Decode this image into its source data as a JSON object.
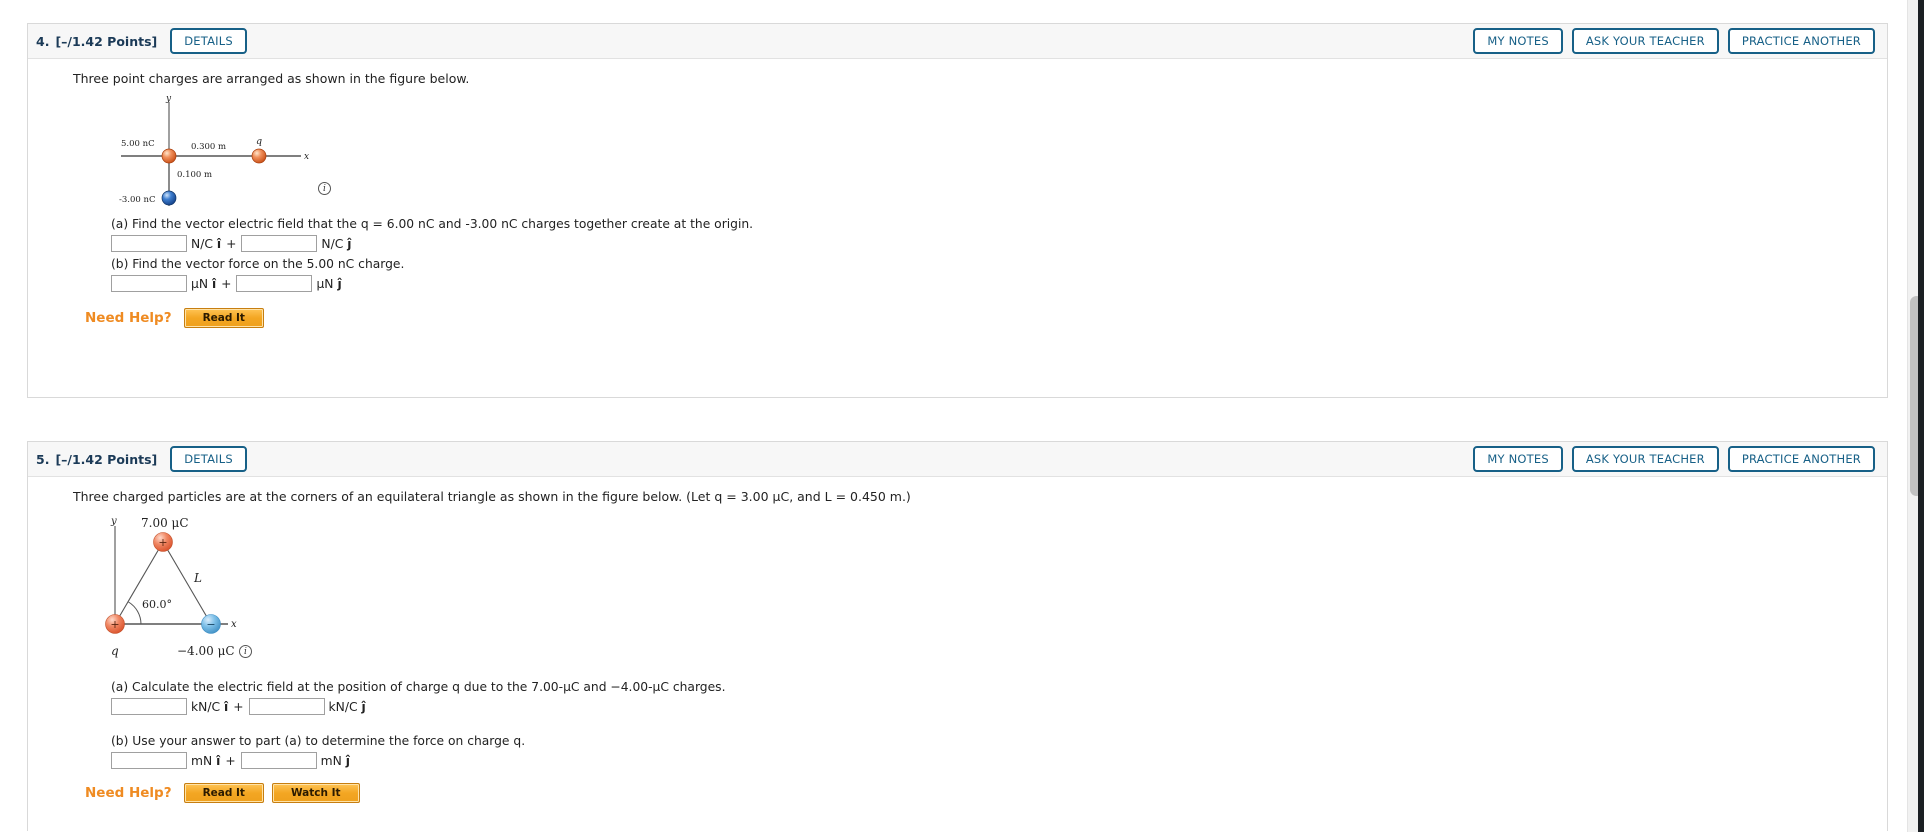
{
  "scrollbar": {
    "present": true
  },
  "questions": [
    {
      "number": "4.",
      "points": "[–/1.42 Points]",
      "details_label": "DETAILS",
      "my_notes_label": "MY NOTES",
      "ask_teacher_label": "ASK YOUR TEACHER",
      "practice_another_label": "PRACTICE ANOTHER",
      "prompt": "Three point charges are arranged as shown in the figure below.",
      "figure": {
        "type": "three-point-charges-axes",
        "axis_x_label": "x",
        "axis_y_label": "y",
        "charge_left_label": "5.00 nC",
        "charge_right_label": "q",
        "charge_bottom_label": "-3.00 nC",
        "distance_horizontal": "0.300 m",
        "distance_vertical": "0.100 m",
        "info_icon": "i"
      },
      "parts": [
        {
          "label": "(a) Find the vector electric field that the q = 6.00 nC and -3.00 nC charges together create at the origin.",
          "input_a_value": "",
          "unit_a": "N/C",
          "unit_a_vector": "î",
          "plus": "+",
          "input_b_value": "",
          "unit_b": "N/C",
          "unit_b_vector": "ĵ"
        },
        {
          "label": "(b) Find the vector force on the 5.00 nC charge.",
          "input_a_value": "",
          "unit_a": "µN",
          "unit_a_vector": "î",
          "plus": "+",
          "input_b_value": "",
          "unit_b": "µN",
          "unit_b_vector": "ĵ"
        }
      ],
      "need_help_label": "Need Help?",
      "help_buttons": [
        "Read It"
      ]
    },
    {
      "number": "5.",
      "points": "[–/1.42 Points]",
      "details_label": "DETAILS",
      "my_notes_label": "MY NOTES",
      "ask_teacher_label": "ASK YOUR TEACHER",
      "practice_another_label": "PRACTICE ANOTHER",
      "prompt": "Three charged particles are at the corners of an equilateral triangle as shown in the figure below. (Let q = 3.00 µC, and L = 0.450 m.)",
      "figure": {
        "type": "equilateral-triangle-charges",
        "axis_x_label": "x",
        "axis_y_label": "y",
        "top_charge_label": "7.00 μC",
        "top_charge_sign": "+",
        "left_charge_label": "q",
        "left_charge_sign": "+",
        "right_charge_label": "−4.00 μC",
        "right_charge_sign": "−",
        "side_label": "L",
        "angle_label": "60.0°",
        "info_icon": "i"
      },
      "parts": [
        {
          "label": "(a) Calculate the electric field at the position of charge q due to the 7.00-µC and −4.00-µC charges.",
          "input_a_value": "",
          "unit_a": "kN/C",
          "unit_a_vector": "î",
          "plus": "+",
          "input_b_value": "",
          "unit_b": "kN/C",
          "unit_b_vector": "ĵ"
        },
        {
          "label": "(b) Use your answer to part (a) to determine the force on charge q.",
          "input_a_value": "",
          "unit_a": "mN",
          "unit_a_vector": "î",
          "plus": "+",
          "input_b_value": "",
          "unit_b": "mN",
          "unit_b_vector": "ĵ"
        }
      ],
      "need_help_label": "Need Help?",
      "help_buttons": [
        "Read It",
        "Watch It"
      ]
    }
  ],
  "colors": {
    "accent_blue": "#176087",
    "help_orange": "#ef8b22",
    "positive_charge": "#e8683c",
    "negative_charge": "#5b9bd5",
    "card_border": "#d9d9d9"
  }
}
